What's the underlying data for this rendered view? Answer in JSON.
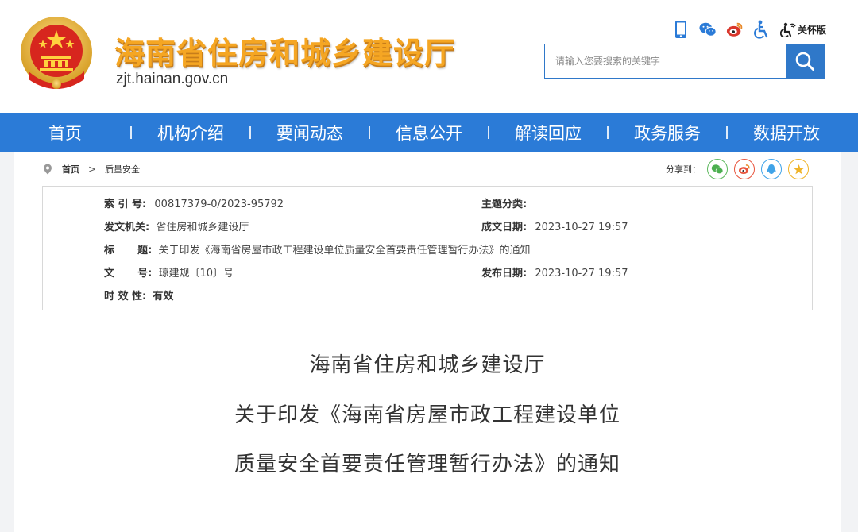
{
  "header": {
    "site_title": "海南省住房和城乡建设厅",
    "site_url": "zjt.hainan.gov.cn",
    "care_mode_label": "关怀版",
    "tool_icons": [
      "mobile-icon",
      "wechat-icon",
      "weibo-icon",
      "accessibility-icon",
      "care-mode-icon"
    ]
  },
  "search": {
    "placeholder": "请输入您要搜索的关键字"
  },
  "nav": {
    "items": [
      {
        "label": "首页"
      },
      {
        "label": "机构介绍"
      },
      {
        "label": "要闻动态"
      },
      {
        "label": "信息公开"
      },
      {
        "label": "解读回应"
      },
      {
        "label": "政务服务"
      },
      {
        "label": "数据开放"
      }
    ]
  },
  "breadcrumb": {
    "home": "首页",
    "sep": ">",
    "current": "质量安全"
  },
  "share": {
    "label": "分享到：",
    "targets": [
      "wechat",
      "weibo",
      "qq",
      "favorite"
    ]
  },
  "meta": {
    "index_label": "索 引 号:",
    "index_value": "00817379-0/2023-95792",
    "topic_label": "主题分类:",
    "topic_value": "",
    "issuer_label": "发文机关:",
    "issuer_value": "省住房和城乡建设厅",
    "created_label": "成文日期:",
    "created_value": "2023-10-27 19:57",
    "title_label_1": "标",
    "title_label_2": "题:",
    "title_value": "关于印发《海南省房屋市政工程建设单位质量安全首要责任管理暂行办法》的通知",
    "docno_label_1": "文",
    "docno_label_2": "号:",
    "docno_value": "琼建规〔10〕号",
    "published_label": "发布日期:",
    "published_value": "2023-10-27 19:57",
    "validity_label": "时 效 性:",
    "validity_value": "有效"
  },
  "document": {
    "title_line1": "海南省住房和城乡建设厅",
    "title_line2": "关于印发《海南省房屋市政工程建设单位",
    "title_line3": "质量安全首要责任管理暂行办法》的通知"
  },
  "colors": {
    "nav_blue": "#2b7bd7",
    "title_orange": "#f5a623",
    "search_blue": "#2f78c9"
  }
}
